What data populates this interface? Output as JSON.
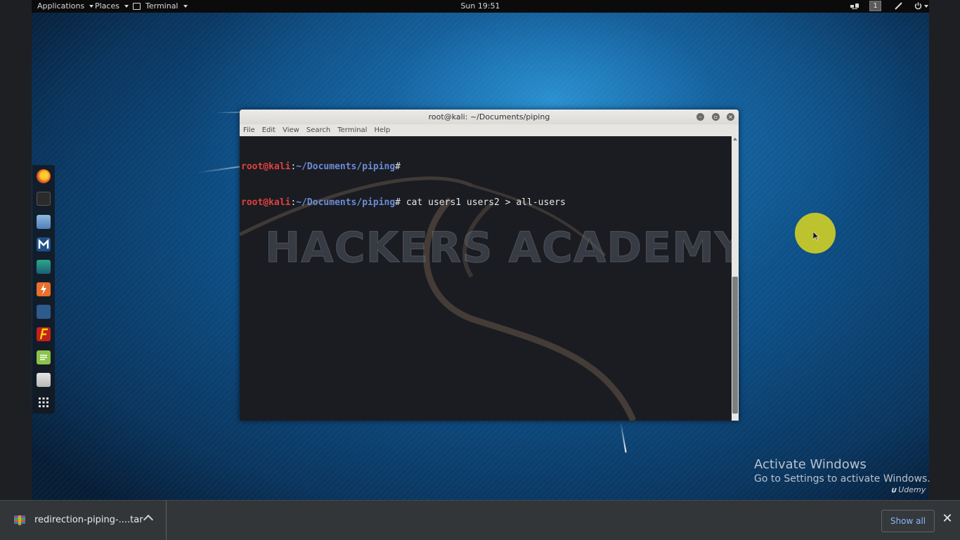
{
  "top_panel": {
    "applications": "Applications",
    "places": "Places",
    "terminal": "Terminal",
    "clock": "Sun 19:51",
    "workspace": "1"
  },
  "dock": {
    "items": [
      "firefox-icon",
      "terminal-icon",
      "files-icon",
      "metasploit-icon",
      "armitage-icon",
      "burpsuite-icon",
      "maltego-icon",
      "faraday-icon",
      "notes-icon",
      "screenshot-icon",
      "show-apps-icon"
    ]
  },
  "terminal": {
    "title": "root@kali: ~/Documents/piping",
    "menu": [
      "File",
      "Edit",
      "View",
      "Search",
      "Terminal",
      "Help"
    ],
    "lines": [
      {
        "user": "root@kali",
        "sep": ":",
        "path": "~/Documents/piping",
        "prompt": "#",
        "cmd": ""
      },
      {
        "user": "root@kali",
        "sep": ":",
        "path": "~/Documents/piping",
        "prompt": "#",
        "cmd": " cat users1 users2 > all-users"
      }
    ],
    "wallpaper_text": "HACKERS ACADEMY"
  },
  "overlay": {
    "activate_title": "Activate Windows",
    "activate_sub": "Go to Settings to activate Windows.",
    "udemy": "Udemy"
  },
  "download_bar": {
    "filename": "redirection-piping-....tar",
    "show_all": "Show all",
    "close": "✕"
  }
}
